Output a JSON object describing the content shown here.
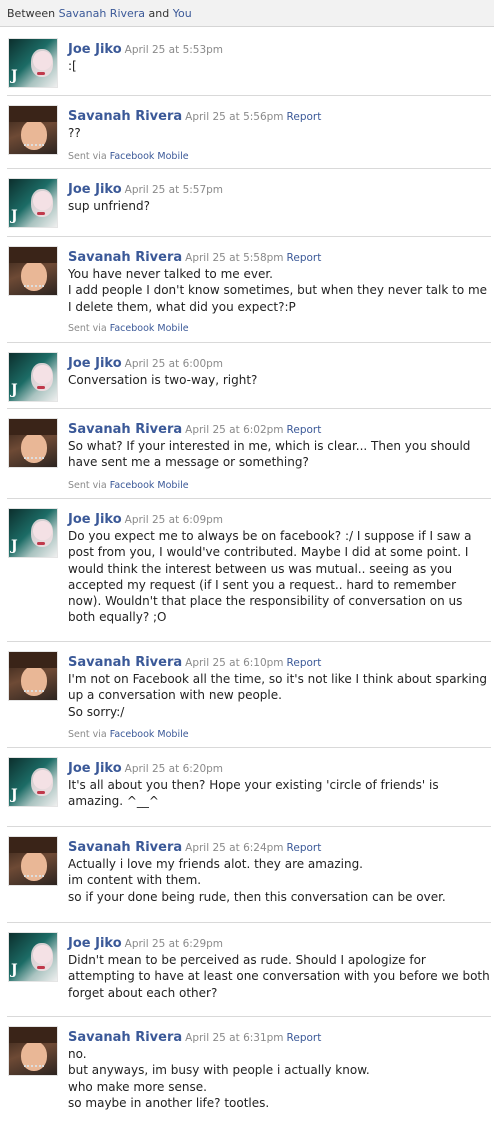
{
  "header": {
    "prefix": "Between",
    "participant": "Savanah Rivera",
    "connector": "and",
    "you": "You"
  },
  "via": {
    "prefix": "Sent via",
    "link": "Facebook Mobile"
  },
  "report_label": "Report",
  "messages": [
    {
      "sender": "Joe Jiko",
      "avatar": "joe",
      "time": "April 25 at 5:53pm",
      "report": false,
      "via": false,
      "lines": [
        ":["
      ]
    },
    {
      "sender": "Savanah Rivera",
      "avatar": "savanah",
      "time": "April 25 at 5:56pm",
      "report": true,
      "via": true,
      "lines": [
        "??"
      ]
    },
    {
      "sender": "Joe Jiko",
      "avatar": "joe",
      "time": "April 25 at 5:57pm",
      "report": false,
      "via": false,
      "lines": [
        "sup unfriend?"
      ]
    },
    {
      "sender": "Savanah Rivera",
      "avatar": "savanah",
      "time": "April 25 at 5:58pm",
      "report": true,
      "via": true,
      "lines": [
        "You have never talked to me ever.",
        "I add people I don't know sometimes, but when they never talk to me",
        "I delete them, what did you expect?:P"
      ]
    },
    {
      "sender": "Joe Jiko",
      "avatar": "joe",
      "time": "April 25 at 6:00pm",
      "report": false,
      "via": false,
      "lines": [
        "Conversation is two-way, right?"
      ]
    },
    {
      "sender": "Savanah Rivera",
      "avatar": "savanah",
      "time": "April 25 at 6:02pm",
      "report": true,
      "via": true,
      "lines": [
        "So what? If your interested in me, which is clear... Then you should",
        "have sent me a message or something?"
      ]
    },
    {
      "sender": "Joe Jiko",
      "avatar": "joe",
      "time": "April 25 at 6:09pm",
      "report": false,
      "via": false,
      "lines": [
        "Do you expect me to always be on facebook? :/ I suppose if I saw a",
        "post from you, I would've contributed. Maybe I did at some point. I",
        "would think the interest between us was mutual.. seeing as you",
        "accepted my request (if I sent you a request.. hard to remember",
        "now). Wouldn't that place the responsibility of conversation on us",
        "both equally? ;O"
      ]
    },
    {
      "sender": "Savanah Rivera",
      "avatar": "savanah",
      "time": "April 25 at 6:10pm",
      "report": true,
      "via": true,
      "lines": [
        "I'm not on Facebook all the time, so it's not like I think about sparking",
        "up a conversation with new people.",
        "So sorry:/"
      ]
    },
    {
      "sender": "Joe Jiko",
      "avatar": "joe",
      "time": "April 25 at 6:20pm",
      "report": false,
      "via": false,
      "lines": [
        "It's all about you then? Hope your existing 'circle of friends' is",
        "amazing. ^__^"
      ]
    },
    {
      "sender": "Savanah Rivera",
      "avatar": "savanah",
      "time": "April 25 at 6:24pm",
      "report": true,
      "via": false,
      "lines": [
        "Actually i love my friends alot. they are amazing.",
        "im content with them.",
        "so if your done being rude, then this conversation can be over."
      ]
    },
    {
      "sender": "Joe Jiko",
      "avatar": "joe",
      "time": "April 25 at 6:29pm",
      "report": false,
      "via": false,
      "lines": [
        "Didn't mean to be perceived as rude. Should I apologize for",
        "attempting to have at least one conversation with you before we both",
        "forget about each other?"
      ]
    },
    {
      "sender": "Savanah Rivera",
      "avatar": "savanah",
      "time": "April 25 at 6:31pm",
      "report": true,
      "via": false,
      "lines": [
        "no.",
        "but anyways, im busy with people i actually know.",
        "who make more sense.",
        "so maybe in another life? tootles."
      ]
    }
  ]
}
